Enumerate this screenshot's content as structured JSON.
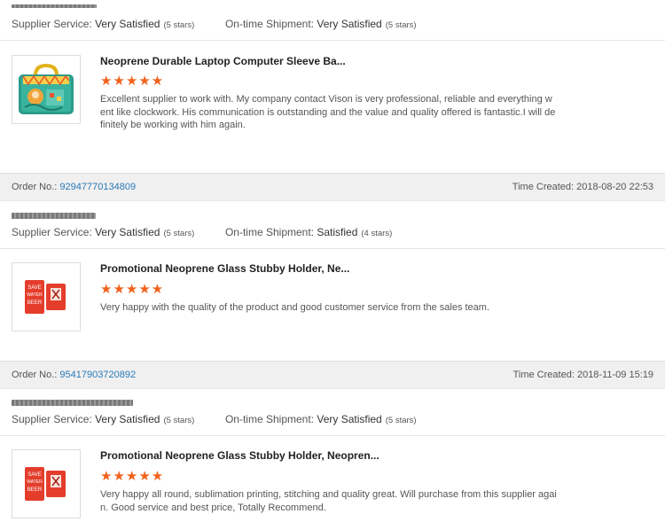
{
  "labels": {
    "supplier_service": "Supplier Service:",
    "ontime_shipment": "On-time Shipment:",
    "order_no": "Order No.:",
    "time_created": "Time Created:"
  },
  "accent_color": "#f0621d",
  "link_color": "#2a7ab8",
  "reviews": [
    {
      "supplier_rating": "Very Satisfied",
      "supplier_stars": "(5 stars)",
      "shipment_rating": "Very Satisfied",
      "shipment_stars": "(5 stars)",
      "product_title": "Neoprene Durable Laptop Computer Sleeve Ba...",
      "stars": "★★★★★",
      "text": "Excellent supplier to work with. My company contact Vison is very professional, reliable and everything went like clockwork. His communication is outstanding and the value and quality offered is fantastic.I will definitely be working with him again.",
      "thumb_icon": "laptop-sleeve-bag-icon"
    },
    {
      "order_no": "92947770134809",
      "time_created": "2018-08-20 22:53",
      "supplier_rating": "Very Satisfied",
      "supplier_stars": "(5 stars)",
      "shipment_rating": "Satisfied",
      "shipment_stars": "(4 stars)",
      "product_title": "Promotional Neoprene Glass Stubby Holder, Ne...",
      "stars": "★★★★★",
      "text": "Very happy with the quality of the product and good customer service from the sales team.",
      "thumb_icon": "stubby-holder-icon"
    },
    {
      "order_no": "95417903720892",
      "time_created": "2018-11-09 15:19",
      "supplier_rating": "Very Satisfied",
      "supplier_stars": "(5 stars)",
      "shipment_rating": "Very Satisfied",
      "shipment_stars": "(5 stars)",
      "product_title": "Promotional Neoprene Glass Stubby Holder, Neopren...",
      "stars": "★★★★★",
      "text": "Very happy all round, sublimation printing, stitching and quality great. Will purchase from this supplier again. Good service and best price, Totally Recommend.",
      "thumb_icon": "stubby-holder-icon"
    }
  ]
}
